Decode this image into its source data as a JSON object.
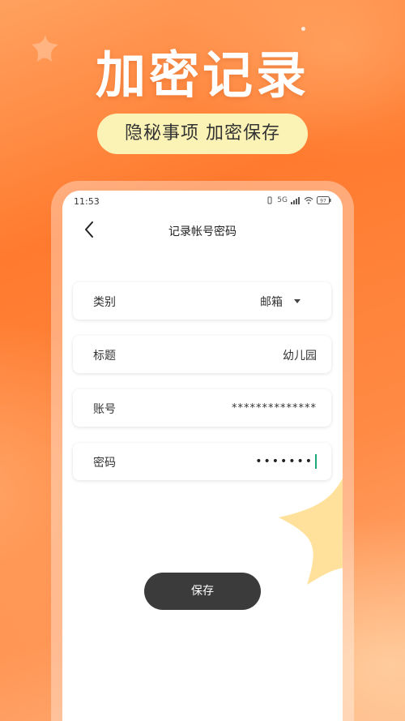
{
  "promo": {
    "title": "加密记录",
    "subtitle": "隐秘事项  加密保存"
  },
  "status_bar": {
    "time": "11:53",
    "signal_label": "5G",
    "battery": "97"
  },
  "screen": {
    "title": "记录帐号密码",
    "fields": [
      {
        "label": "类别",
        "value": "邮箱"
      },
      {
        "label": "标题",
        "value": "幼儿园"
      },
      {
        "label": "账号",
        "value": "**************"
      },
      {
        "label": "密码",
        "value": "•••••••"
      }
    ],
    "save_label": "保存"
  },
  "colors": {
    "accent": "#ff7a2e",
    "pill_bg": "#fbf3b5",
    "button_bg": "#3b3b3b",
    "cursor": "#1aa876"
  }
}
